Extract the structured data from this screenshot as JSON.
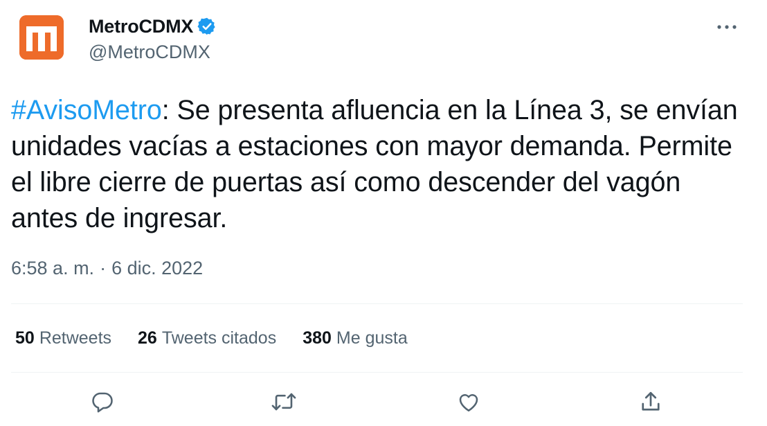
{
  "author": {
    "display_name": "MetroCDMX",
    "handle": "@MetroCDMX",
    "verified": true,
    "avatar_icon": "metro-logo-icon",
    "avatar_color": "#ee6b2a"
  },
  "tweet": {
    "hashtag": "#AvisoMetro",
    "body": ": Se presenta afluencia en la Línea 3, se envían unidades vacías a estaciones con mayor demanda. Permite el libre cierre de puertas así como descender del vagón antes de ingresar.",
    "time": "6:58 a. m.",
    "separator": "·",
    "date": "6 dic. 2022"
  },
  "stats": {
    "retweets_count": "50",
    "retweets_label": "Retweets",
    "quotes_count": "26",
    "quotes_label": "Tweets citados",
    "likes_count": "380",
    "likes_label": "Me gusta"
  },
  "actions": [
    "reply-icon",
    "retweet-icon",
    "like-icon",
    "share-icon"
  ],
  "colors": {
    "accent": "#1d9bf0",
    "text": "#0f1419",
    "secondary": "#536471"
  }
}
